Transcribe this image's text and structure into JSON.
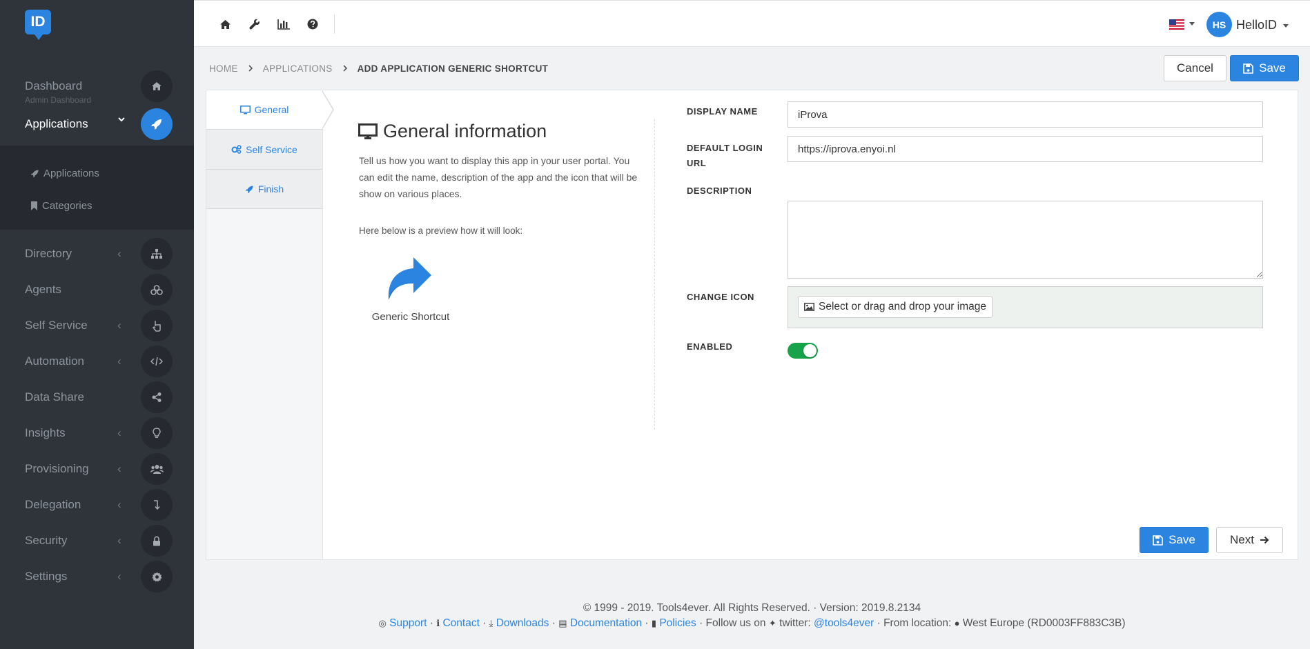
{
  "logo": {
    "text": "ID"
  },
  "sidebar": {
    "items": [
      {
        "label": "Dashboard",
        "sublabel": "Admin Dashboard",
        "icon": "home-icon",
        "chevron": ""
      },
      {
        "label": "Applications",
        "icon": "rocket-icon",
        "chevron": "⌄"
      },
      {
        "label": "Directory",
        "icon": "sitemap-icon",
        "chevron": "‹"
      },
      {
        "label": "Agents",
        "icon": "cubes-icon",
        "chevron": ""
      },
      {
        "label": "Self Service",
        "icon": "hand-pointer-icon",
        "chevron": "‹"
      },
      {
        "label": "Automation",
        "icon": "code-icon",
        "chevron": "‹"
      },
      {
        "label": "Data Share",
        "icon": "share-alt-icon",
        "chevron": ""
      },
      {
        "label": "Insights",
        "icon": "lightbulb-icon",
        "chevron": "‹"
      },
      {
        "label": "Provisioning",
        "icon": "users-icon",
        "chevron": "‹"
      },
      {
        "label": "Delegation",
        "icon": "level-down-icon",
        "chevron": "‹"
      },
      {
        "label": "Security",
        "icon": "lock-icon",
        "chevron": "‹"
      },
      {
        "label": "Settings",
        "icon": "cog-icon",
        "chevron": "‹"
      }
    ],
    "submenu": [
      {
        "label": "Applications",
        "icon": "rocket-icon"
      },
      {
        "label": "Categories",
        "icon": "bookmark-icon"
      }
    ]
  },
  "topbar": {
    "icons": [
      "home-icon",
      "wrench-icon",
      "bar-chart-icon",
      "question-circle-icon"
    ],
    "user_initials": "HS",
    "user_name": "HelloID"
  },
  "breadcrumb": {
    "items": [
      "HOME",
      "APPLICATIONS",
      "ADD APPLICATION GENERIC SHORTCUT"
    ]
  },
  "header_actions": {
    "cancel_label": "Cancel",
    "save_label": "Save"
  },
  "tabs": [
    {
      "label": "General",
      "icon": "desktop-icon"
    },
    {
      "label": "Self Service",
      "icon": "cogs-icon"
    },
    {
      "label": "Finish",
      "icon": "rocket-icon"
    }
  ],
  "general": {
    "title": "General information",
    "description": "Tell us how you want to display this app in your user portal. You can edit the name, description of the app and the icon that will be show on various places.",
    "preview_label": "Here below is a preview how it will look:",
    "preview_app_name": "Generic Shortcut"
  },
  "form": {
    "display_name_label": "DISPLAY NAME",
    "display_name_value": "iProva",
    "login_url_label": "DEFAULT LOGIN URL",
    "login_url_value": "https://iprova.enyoi.nl",
    "description_label": "DESCRIPTION",
    "description_value": "",
    "change_icon_label": "CHANGE ICON",
    "change_icon_button": "Select or drag and drop your image",
    "enabled_label": "ENABLED",
    "enabled": true
  },
  "footer_actions": {
    "save_label": "Save",
    "next_label": "Next"
  },
  "footer": {
    "copyright": "© 1999 - 2019. Tools4ever. All Rights Reserved. · Version: 2019.8.2134",
    "support": "Support",
    "contact": "Contact",
    "downloads": "Downloads",
    "documentation": "Documentation",
    "policies": "Policies",
    "follow": "· Follow us on",
    "twitter_prefix": "twitter:",
    "twitter_handle": "@tools4ever",
    "location": "· From location:",
    "region": "West Europe (RD0003FF883C3B)"
  },
  "colors": {
    "accent": "#2c84e1",
    "sidebar": "#2f343b",
    "toggle_on": "#17a34a"
  }
}
